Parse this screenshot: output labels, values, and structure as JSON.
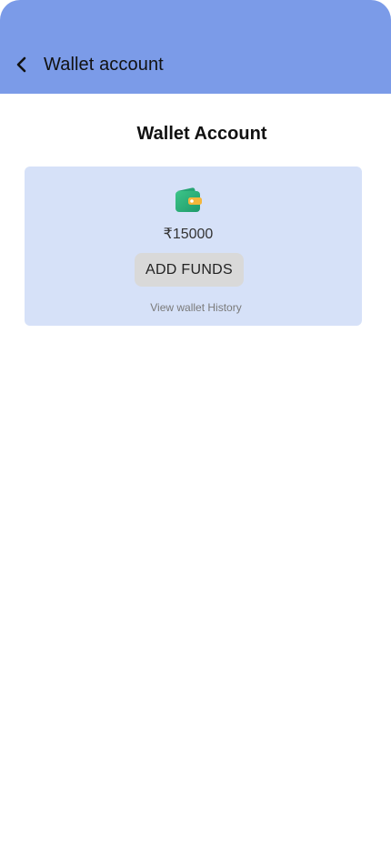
{
  "header": {
    "title": "Wallet account",
    "background_color": "#7b9be8",
    "back_icon": "chevron-left-icon"
  },
  "page": {
    "title": "Wallet Account"
  },
  "wallet": {
    "icon": "wallet-icon",
    "balance": "₹15000",
    "add_funds_label": "ADD FUNDS",
    "history_link": "View wallet History",
    "card_color": "#d6e1f8",
    "icon_color": "#2fb07a"
  }
}
